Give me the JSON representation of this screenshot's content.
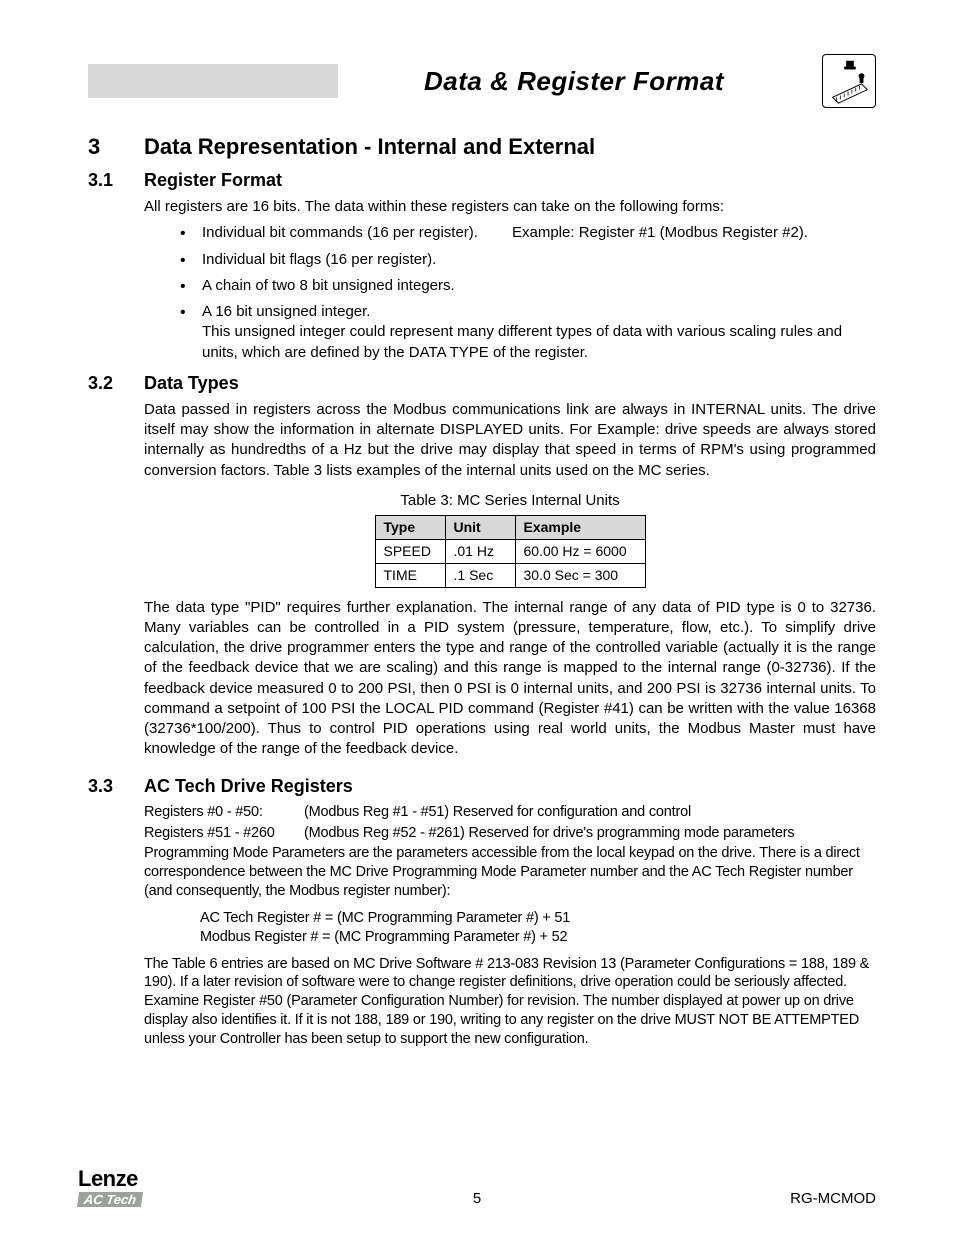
{
  "header": {
    "title": "Data & Register Format"
  },
  "section": {
    "num": "3",
    "title": "Data Representation - Internal and External"
  },
  "s31": {
    "num": "3.1",
    "title": "Register Format",
    "intro": "All registers are 16 bits. The data within these registers can take on the following forms:",
    "b1_left": "Individual bit commands (16 per register).",
    "b1_right": "Example: Register #1 (Modbus Register #2).",
    "b2": "Individual bit flags (16 per register).",
    "b3": "A chain of two 8 bit unsigned integers.",
    "b4": "A 16 bit unsigned integer.",
    "b4_sub": "This unsigned integer could represent many different types of data with various scaling rules and units, which are defined by the DATA TYPE of the register."
  },
  "s32": {
    "num": "3.2",
    "title": "Data Types",
    "p1": "Data passed in registers across the Modbus communications link are always in INTERNAL units. The drive itself may show the information in alternate DISPLAYED units. For Example: drive speeds are always stored internally as hundredths of a Hz but the drive may display that speed in terms of RPM's using programmed conversion factors. Table 3 lists examples of the internal units used on the MC series.",
    "table_caption": "Table 3: MC Series Internal Units",
    "th1": "Type",
    "th2": "Unit",
    "th3": "Example",
    "r1c1": "SPEED",
    "r1c2": ".01 Hz",
    "r1c3": "60.00 Hz = 6000",
    "r2c1": "TIME",
    "r2c2": ".1 Sec",
    "r2c3": "30.0 Sec = 300",
    "p2": "The data type \"PID\" requires further explanation. The internal range of any data of PID type is 0 to 32736. Many variables can be controlled in a PID system (pressure, temperature, flow, etc.). To simplify drive calculation, the drive programmer enters the type and range of the controlled variable (actually it is the range of the feedback device that we are scaling) and this range is mapped to the internal range (0-32736). If the feedback device measured 0 to 200 PSI, then 0 PSI is 0 internal units, and 200 PSI is 32736 internal units. To command a setpoint of 100 PSI the LOCAL PID command (Register #41) can be written with the value 16368 (32736*100/200). Thus to control PID operations using real world units, the Modbus Master must have knowledge of the range of the feedback device."
  },
  "s33": {
    "num": "3.3",
    "title": "AC Tech Drive Registers",
    "l1a": "Registers #0 - #50:",
    "l1b": "(Modbus Reg #1 - #51) Reserved for configuration and control",
    "l2a": "Registers #51 - #260",
    "l2b": "(Modbus Reg #52 - #261) Reserved for drive's programming mode parameters",
    "p1": "Programming Mode Parameters are the parameters accessible from the local keypad on the drive. There is a direct correspondence between the MC Drive Programming Mode Parameter number and the AC Tech Register number (and consequently, the Modbus register number):",
    "f1": "AC Tech Register # = (MC Programming Parameter #) + 51",
    "f2": "Modbus Register # = (MC Programming Parameter #) + 52",
    "p2": "The Table 6 entries are based on MC Drive Software # 213-083 Revision 13 (Parameter Configurations = 188, 189 & 190). If a later revision of software were to change register definitions, drive operation could be seriously affected. Examine Register #50 (Parameter Configuration Number) for revision. The number displayed at power up on drive display also identifies it. If it is not 188, 189 or 190, writing to any register on the drive MUST NOT BE ATTEMPTED unless your Controller has been setup to support the new configuration."
  },
  "footer": {
    "page": "5",
    "doc": "RG-MCMOD",
    "logo_top": "Lenze",
    "logo_bottom": "AC Tech"
  }
}
